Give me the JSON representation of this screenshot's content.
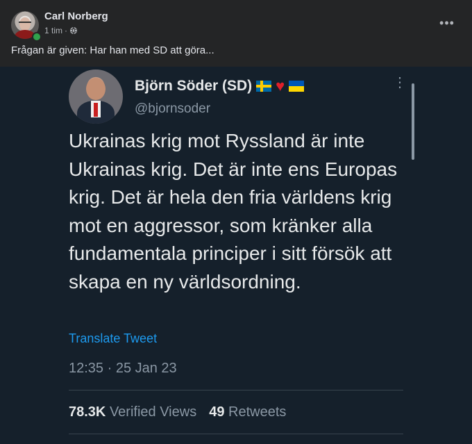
{
  "post": {
    "author_name": "Carl Norberg",
    "time_ago": "1 tim",
    "separator": "·",
    "text": "Frågan är given: Har han med SD att göra...",
    "more_label": "•••"
  },
  "tweet": {
    "name": "Björn Söder (SD)",
    "handle": "@bjornsoder",
    "text": "Ukrainas krig mot Ryssland är inte Ukrainas krig. Det är inte ens Europas krig. Det är hela den fria världens krig mot en aggressor, som kränker alla fundamentala principer i sitt försök att skapa en ny världsordning.",
    "translate_label": "Translate Tweet",
    "timestamp": "12:35 · 25 Jan 23",
    "views_count": "78.3K",
    "views_label": "Verified Views",
    "retweets_count": "49",
    "retweets_label": "Retweets",
    "more_label": "⋮"
  },
  "colors": {
    "facebook_bg": "#242526",
    "twitter_bg": "#15202b",
    "link": "#1d9bf0",
    "online": "#31a24c"
  },
  "icons": {
    "globe": "globe-icon",
    "more": "more-horizontal-icon",
    "verified_flags": [
      "sweden-flag-icon",
      "red-heart-icon",
      "ukraine-flag-icon"
    ]
  }
}
